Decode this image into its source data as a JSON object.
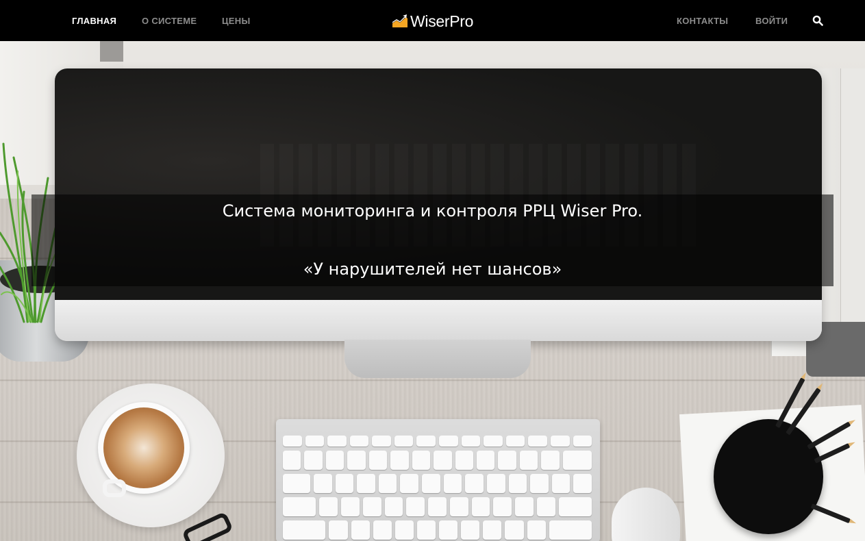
{
  "nav": {
    "left_items": [
      {
        "label": "ГЛАВНАЯ",
        "active": true
      },
      {
        "label": "О СИСТЕМЕ",
        "active": false
      },
      {
        "label": "ЦЕНЫ",
        "active": false
      }
    ],
    "right_items": [
      {
        "label": "КОНТАКТЫ"
      },
      {
        "label": "ВОЙТИ"
      }
    ],
    "search_icon": "search-icon"
  },
  "logo": {
    "text": "WiserPro",
    "icon": "rising-chart-icon",
    "icon_color": "#f5a623"
  },
  "hero": {
    "title": "Система мониторинга и контроля РРЦ Wiser Pro.",
    "tagline": "«У нарушителей нет шансов»"
  },
  "colors": {
    "nav_background": "#000000",
    "nav_active": "#ffffff",
    "nav_inactive": "#8d8d8d"
  }
}
